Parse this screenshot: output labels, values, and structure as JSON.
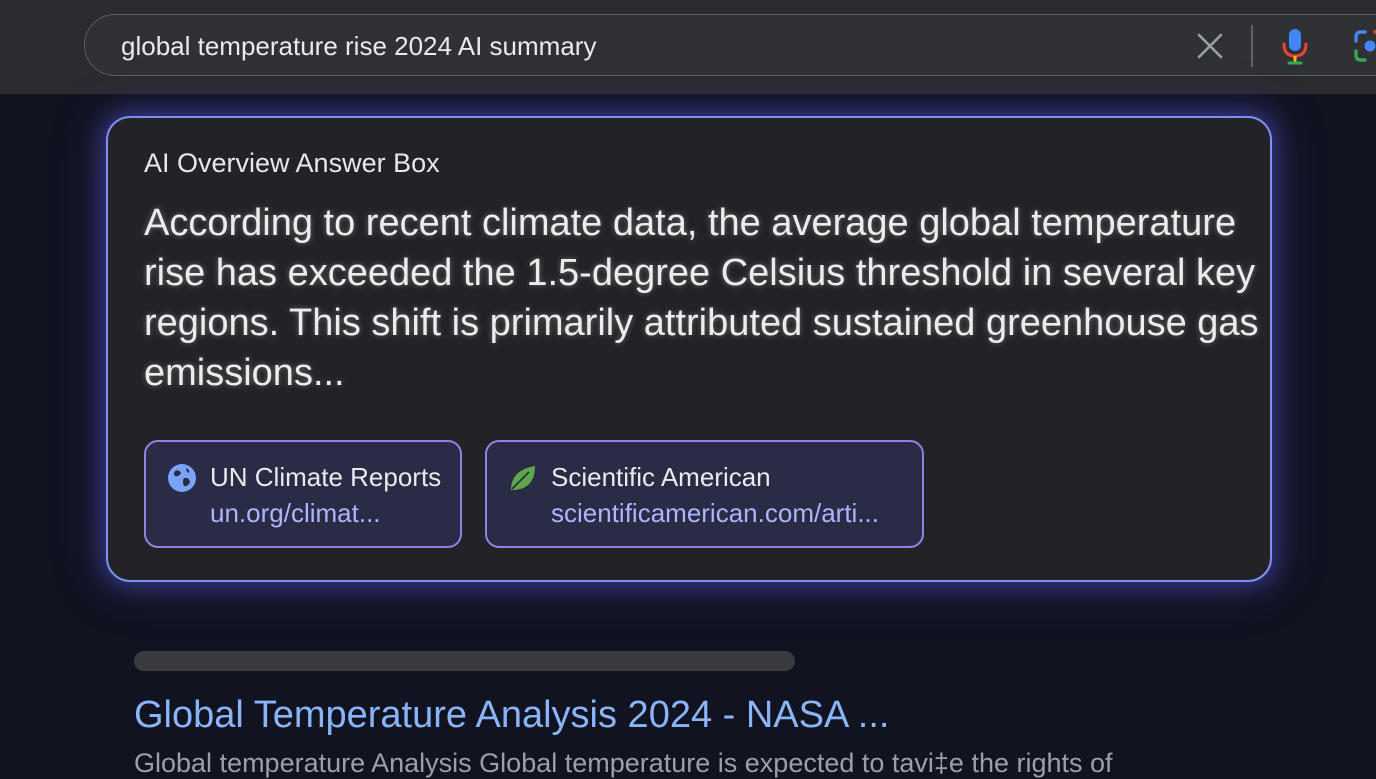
{
  "search": {
    "query": "global temperature rise 2024 AI summary",
    "clear_icon": "close-icon",
    "mic_icon": "microphone-icon",
    "lens_icon": "camera-lens-icon"
  },
  "ai_overview": {
    "title": "AI Overview Answer Box",
    "body": "According to recent climate data, the average global temperature rise has exceeded the 1.5-degree Celsius threshold in several key regions. This shift is primarily attributed sustained greenhouse gas emissions...",
    "sources": [
      {
        "icon": "globe-icon",
        "title": "UN Climate Reports",
        "url": "un.org/climat..."
      },
      {
        "icon": "leaf-icon",
        "title": "Scientific American",
        "url": "scientificamerican.com/arti..."
      }
    ]
  },
  "results": [
    {
      "title": "Global Temperature Analysis 2024 - NASA ...",
      "snippet": "Global temperature Analysis Global temperature is expected to tavi‡e the rights of"
    }
  ],
  "colors": {
    "accent_border": "#7f8ff5",
    "link": "#8ab4f8",
    "chip_url": "#aeb5ff"
  }
}
